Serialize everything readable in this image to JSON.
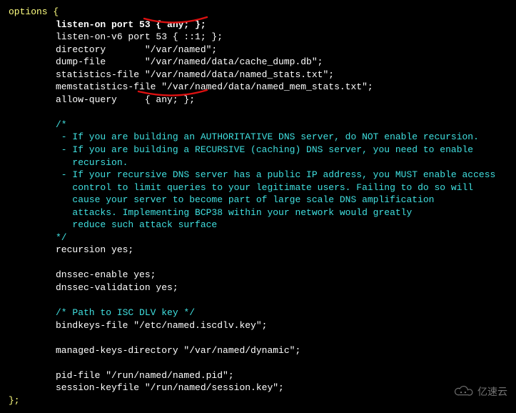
{
  "code": {
    "l0": "options {",
    "l1a": "listen-on port 53 { ",
    "l1b": "any;",
    "l1c": " };",
    "l2": "listen-on-v6 port 53 { ::1; };",
    "l3": "directory       \"/var/named\";",
    "l4": "dump-file       \"/var/named/data/cache_dump.db\";",
    "l5": "statistics-file \"/var/named/data/named_stats.txt\";",
    "l6": "memstatistics-file \"/var/named/data/named_mem_stats.txt\";",
    "l7": "allow-query     { any; };",
    "c0": "/*",
    "c1": " - If you are building an AUTHORITATIVE DNS server, do NOT enable recursion.",
    "c2": " - If you are building a RECURSIVE (caching) DNS server, you need to enable",
    "c3": "   recursion.",
    "c4": " - If your recursive DNS server has a public IP address, you MUST enable access",
    "c5": "   control to limit queries to your legitimate users. Failing to do so will",
    "c6": "   cause your server to become part of large scale DNS amplification",
    "c7": "   attacks. Implementing BCP38 within your network would greatly",
    "c8": "   reduce such attack surface",
    "c9": "*/",
    "l8": "recursion yes;",
    "l9": "dnssec-enable yes;",
    "l10": "dnssec-validation yes;",
    "c10": "/* Path to ISC DLV key */",
    "l11": "bindkeys-file \"/etc/named.iscdlv.key\";",
    "l12": "managed-keys-directory \"/var/named/dynamic\";",
    "l13": "pid-file \"/run/named/named.pid\";",
    "l14": "session-keyfile \"/run/named/session.key\";",
    "l15": "};"
  },
  "watermark": "亿速云"
}
